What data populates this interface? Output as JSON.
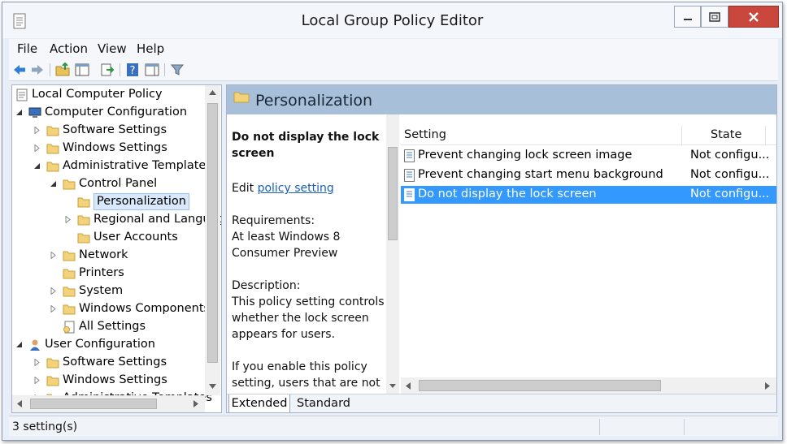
{
  "window": {
    "title": "Local Group Policy Editor"
  },
  "menu": [
    "File",
    "Action",
    "View",
    "Help"
  ],
  "toolbar": {
    "icons": [
      "back-icon",
      "forward-icon",
      "up-folder-icon",
      "show-hide-tree-icon",
      "export-list-icon",
      "help-icon",
      "show-hide-action-pane-icon",
      "filter-icon"
    ]
  },
  "tree": {
    "items": [
      {
        "label": "Local Computer Policy",
        "level": 0,
        "expander": "none",
        "icon": "policy-doc-icon"
      },
      {
        "label": "Computer Configuration",
        "level": 1,
        "expander": "expanded",
        "icon": "computer-icon"
      },
      {
        "label": "Software Settings",
        "level": 2,
        "expander": "collapsed",
        "icon": "folder-icon"
      },
      {
        "label": "Windows Settings",
        "level": 2,
        "expander": "collapsed",
        "icon": "folder-icon"
      },
      {
        "label": "Administrative Templates",
        "level": 2,
        "expander": "expanded",
        "icon": "folder-icon"
      },
      {
        "label": "Control Panel",
        "level": 3,
        "expander": "expanded",
        "icon": "folder-icon"
      },
      {
        "label": "Personalization",
        "level": 4,
        "expander": "none",
        "icon": "folder-icon",
        "selected": true
      },
      {
        "label": "Regional and Language",
        "level": 4,
        "expander": "collapsed",
        "icon": "folder-icon"
      },
      {
        "label": "User Accounts",
        "level": 4,
        "expander": "none",
        "icon": "folder-icon"
      },
      {
        "label": "Network",
        "level": 3,
        "expander": "collapsed",
        "icon": "folder-icon"
      },
      {
        "label": "Printers",
        "level": 3,
        "expander": "none",
        "icon": "folder-icon"
      },
      {
        "label": "System",
        "level": 3,
        "expander": "collapsed",
        "icon": "folder-icon"
      },
      {
        "label": "Windows Components",
        "level": 3,
        "expander": "collapsed",
        "icon": "folder-icon"
      },
      {
        "label": "All Settings",
        "level": 3,
        "expander": "none",
        "icon": "all-settings-icon"
      },
      {
        "label": "User Configuration",
        "level": 1,
        "expander": "expanded",
        "icon": "user-icon"
      },
      {
        "label": "Software Settings",
        "level": 2,
        "expander": "collapsed",
        "icon": "folder-icon"
      },
      {
        "label": "Windows Settings",
        "level": 2,
        "expander": "collapsed",
        "icon": "folder-icon"
      },
      {
        "label": "Administrative Templates",
        "level": 2,
        "expander": "collapsed",
        "icon": "folder-icon"
      }
    ]
  },
  "section": {
    "heading": "Personalization"
  },
  "description": {
    "title": "Do not display the lock screen",
    "edit_prefix": "Edit ",
    "edit_link": "policy setting ",
    "requirements_label": "Requirements:",
    "requirements_value": "At least Windows 8 Consumer Preview",
    "description_label": "Description:",
    "description_text": "This policy setting controls whether the lock screen appears for users.",
    "enable_text": "If you enable this policy setting, users that are not"
  },
  "settings_list": {
    "columns": [
      "Setting",
      "State"
    ],
    "rows": [
      {
        "name": "Prevent changing lock screen image",
        "state": "Not configu..."
      },
      {
        "name": "Prevent changing start menu background",
        "state": "Not configu..."
      },
      {
        "name": "Do not display the lock screen",
        "state": "Not configu...",
        "selected": true
      }
    ]
  },
  "tabs": [
    "Extended",
    "Standard"
  ],
  "status": {
    "text": "3 setting(s)"
  },
  "colors": {
    "selection": "#3399ff",
    "section_header": "#a8bfd9",
    "close_button": "#c9473c"
  }
}
